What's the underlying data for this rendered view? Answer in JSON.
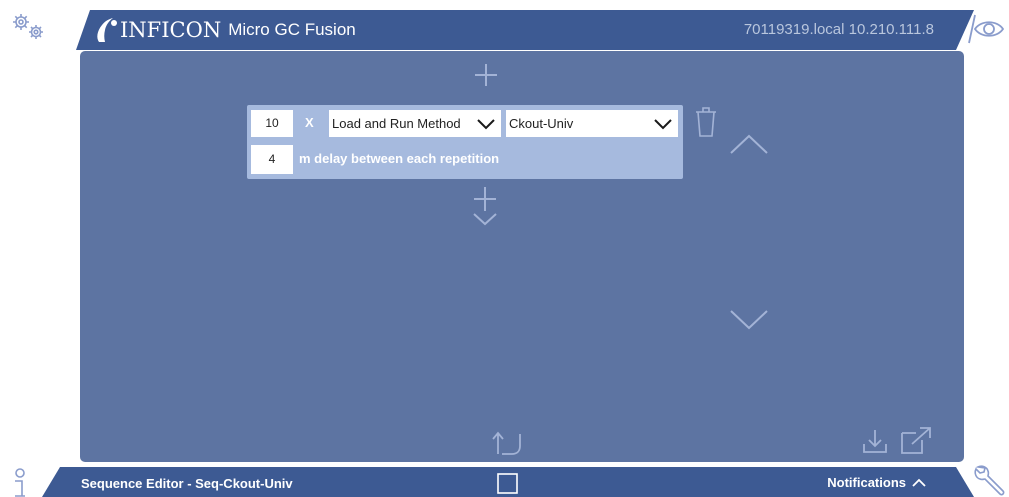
{
  "header": {
    "brand": "INFICON",
    "product": "Micro GC Fusion",
    "host_info": "70119319.local 10.210.111.8"
  },
  "sequence_row": {
    "repeat_count": "10",
    "times_label": "X",
    "action": "Load and Run Method",
    "method": "Ckout-Univ",
    "delay_value": "4",
    "delay_label": "m delay between each repetition"
  },
  "footer": {
    "title": "Sequence Editor - Seq-Ckout-Univ",
    "notifications_label": "Notifications"
  },
  "colors": {
    "panel": "#5d74a2",
    "card": "#a6bade",
    "bar": "#3d5a93",
    "icon": "#a3b3d6"
  },
  "icons": [
    "settings-gears-icon",
    "view-eye-icon",
    "add-above-icon",
    "delete-trash-icon",
    "move-up-icon",
    "move-down-icon",
    "insert-below-icon",
    "undo-icon",
    "download-icon",
    "open-external-icon",
    "info-icon",
    "wrench-icon",
    "stop-square-icon",
    "chevron-up-icon"
  ]
}
